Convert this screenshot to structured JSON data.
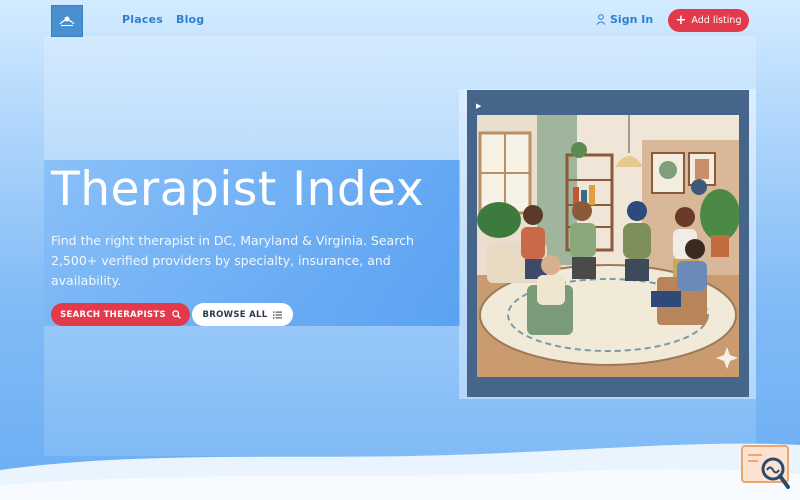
{
  "header": {
    "nav": [
      {
        "label": "Places"
      },
      {
        "label": "Blog"
      }
    ],
    "signin_label": "Sign In",
    "add_listing_label": "Add listing"
  },
  "hero": {
    "title": "Therapist Index",
    "subtitle": "Find the right therapist in DC, Maryland & Virginia. Search 2,500+ verified providers by specialty, insurance, and availability.",
    "search_button": "SEARCH THERAPISTS",
    "browse_button": "BROWSE ALL"
  },
  "colors": {
    "accent_red": "#e23a4a",
    "link_blue": "#2f7fd0",
    "frame_blue": "#45658a"
  },
  "icons": [
    "logo-icon",
    "user-icon",
    "plus-icon",
    "search-icon",
    "list-icon",
    "play-icon",
    "search-brand-icon"
  ]
}
